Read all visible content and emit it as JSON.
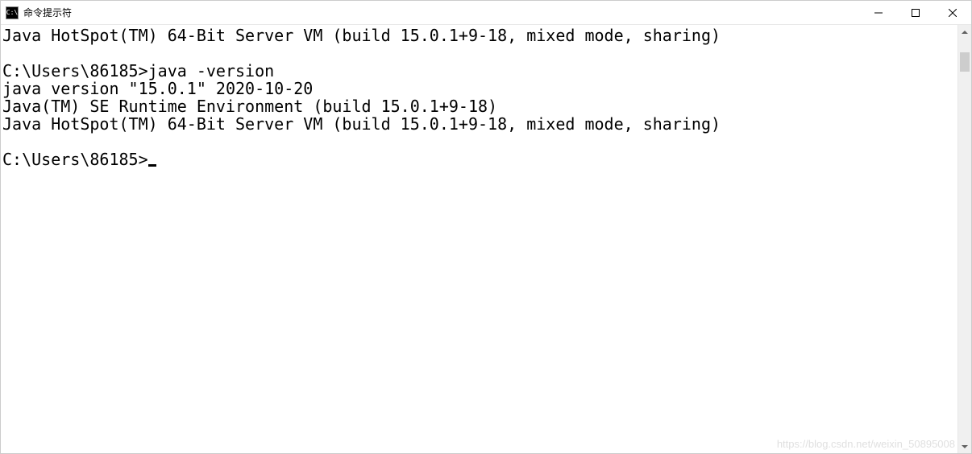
{
  "window": {
    "title": "命令提示符",
    "icon_label": "C:\\"
  },
  "terminal": {
    "lines": [
      "Java HotSpot(TM) 64-Bit Server VM (build 15.0.1+9-18, mixed mode, sharing)",
      "",
      "C:\\Users\\86185>java -version",
      "java version \"15.0.1\" 2020-10-20",
      "Java(TM) SE Runtime Environment (build 15.0.1+9-18)",
      "Java HotSpot(TM) 64-Bit Server VM (build 15.0.1+9-18, mixed mode, sharing)",
      "",
      "C:\\Users\\86185>"
    ],
    "prompt_path": "C:\\Users\\86185",
    "last_command": "java -version"
  },
  "watermark": "https://blog.csdn.net/weixin_50895008"
}
